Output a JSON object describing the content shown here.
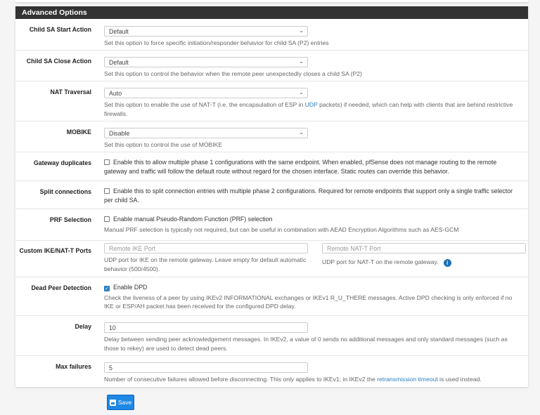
{
  "panel_title": "Advanced Options",
  "rows": {
    "child_start": {
      "label": "Child SA Start Action",
      "value": "Default",
      "help": "Set this option to force specific initiation/responder behavior for child SA (P2) entries"
    },
    "child_close": {
      "label": "Child SA Close Action",
      "value": "Default",
      "help": "Set this option to control the behavior when the remote peer unexpectedly closes a child SA (P2)"
    },
    "nat": {
      "label": "NAT Traversal",
      "value": "Auto",
      "help_pre": "Set this option to enable the use of NAT-T (i.e. the encapsulation of ESP in ",
      "help_link": "UDP",
      "help_post": " packets) if needed, which can help with clients that are behind restrictive firewalls."
    },
    "mobike": {
      "label": "MOBIKE",
      "value": "Disable",
      "help": "Set this option to control the use of MOBIKE"
    },
    "gwdup": {
      "label": "Gateway duplicates",
      "checked": false,
      "text": "Enable this to allow multiple phase 1 configurations with the same endpoint. When enabled, pfSense does not manage routing to the remote gateway and traffic will follow the default route without regard for the chosen interface. Static routes can override this behavior."
    },
    "split": {
      "label": "Split connections",
      "checked": false,
      "text": "Enable this to split connection entries with multiple phase 2 configurations. Required for remote endpoints that support only a single traffic selector per child SA."
    },
    "prf": {
      "label": "PRF Selection",
      "checked": false,
      "text": "Enable manual Pseudo-Random Function (PRF) selection",
      "help": "Manual PRF selection is typically not required, but can be useful in combination with AEAD Encryption Algorithms such as AES-GCM"
    },
    "ports": {
      "label": "Custom IKE/NAT-T Ports",
      "ike_placeholder": "Remote IKE Port",
      "ike_help": "UDP port for IKE on the remote gateway. Leave empty for default automatic behavior (500/4500).",
      "natt_placeholder": "Remote NAT-T Port",
      "natt_help": "UDP port for NAT-T on the remote gateway.",
      "info_icon": "i"
    },
    "dpd": {
      "label": "Dead Peer Detection",
      "checked": true,
      "text": "Enable DPD",
      "help": "Check the liveness of a peer by using IKEv2 INFORMATIONAL exchanges or IKEv1 R_U_THERE messages. Active DPD checking is only enforced if no IKE or ESP/AH packet has been received for the configured DPD delay."
    },
    "delay": {
      "label": "Delay",
      "value": "10",
      "help": "Delay between sending peer acknowledgement messages. In IKEv2, a value of 0 sends no additional messages and only standard messages (such as those to rekey) are used to detect dead peers."
    },
    "maxfail": {
      "label": "Max failures",
      "value": "5",
      "help_pre": "Number of consecutive failures allowed before disconnecting. This only applies to IKEv1; in IKEv2 the ",
      "help_link": "retransmission timeout",
      "help_post": " is used instead."
    }
  },
  "save_label": "Save"
}
